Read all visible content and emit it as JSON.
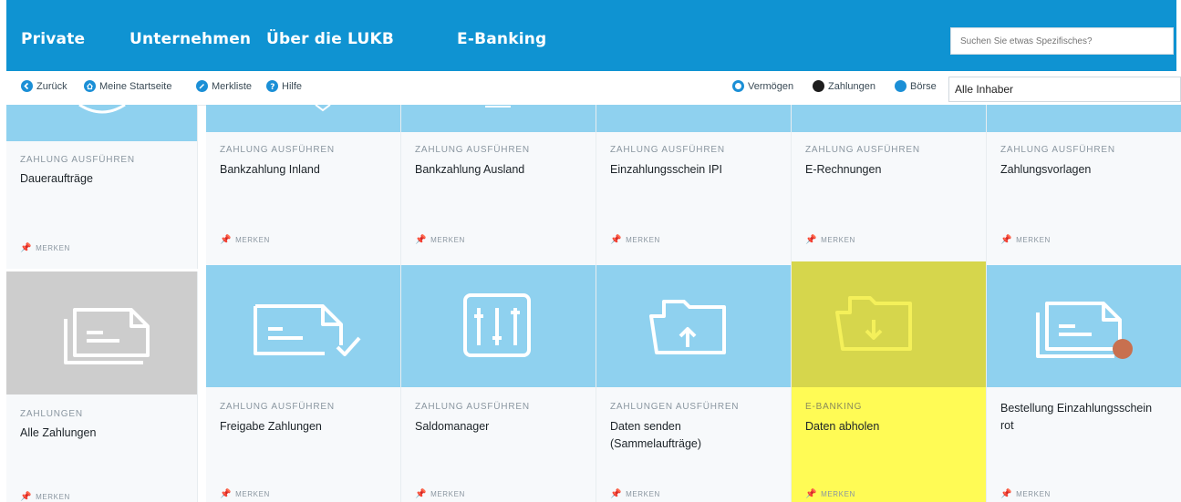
{
  "topnav": {
    "items": [
      "Private",
      "Unternehmen",
      "Über die LUKB",
      "E-Banking"
    ],
    "search_placeholder": "Suchen Sie etwas Spezifisches?"
  },
  "toolbar": {
    "back": "Zurück",
    "home": "Meine Startseite",
    "bookmarks": "Merkliste",
    "help": "Hilfe",
    "wealth": "Vermögen",
    "payments": "Zahlungen",
    "exchange": "Börse",
    "owner_select": "Alle Inhaber"
  },
  "merken_label": "MERKEN",
  "row1": [
    {
      "category": "ZAHLUNG AUSFÜHREN",
      "title": "Daueraufträge"
    },
    {
      "category": "ZAHLUNG AUSFÜHREN",
      "title": "Bankzahlung Inland"
    },
    {
      "category": "ZAHLUNG AUSFÜHREN",
      "title": "Bankzahlung Ausland"
    },
    {
      "category": "ZAHLUNG AUSFÜHREN",
      "title": "Einzahlungsschein IPI"
    },
    {
      "category": "ZAHLUNG AUSFÜHREN",
      "title": "E-Rechnungen"
    },
    {
      "category": "ZAHLUNG AUSFÜHREN",
      "title": "Zahlungsvorlagen"
    }
  ],
  "row2": [
    {
      "category": "ZAHLUNGEN",
      "title": "Alle Zahlungen",
      "icon": "payment-slips-icon"
    },
    {
      "category": "ZAHLUNG AUSFÜHREN",
      "title": "Freigabe Zahlungen",
      "icon": "payment-approve-icon"
    },
    {
      "category": "ZAHLUNG AUSFÜHREN",
      "title": "Saldomanager",
      "icon": "sliders-icon"
    },
    {
      "category": "ZAHLUNGEN AUSFÜHREN",
      "title": "Daten senden (Sammelaufträge)",
      "icon": "folder-upload-icon"
    },
    {
      "category": "E-BANKING",
      "title": "Daten abholen",
      "icon": "folder-download-icon"
    },
    {
      "category": "",
      "title": "Bestellung Einzahlungsschein rot",
      "icon": "payment-slip-red-icon"
    }
  ],
  "colors": {
    "brand": "#0f93d2",
    "tile_blue": "#8fd1ef",
    "tile_grey": "#cdcdcd",
    "highlight": "#fffb55",
    "highlight_tile": "#d6d64c",
    "red_dot": "#c8704f"
  }
}
